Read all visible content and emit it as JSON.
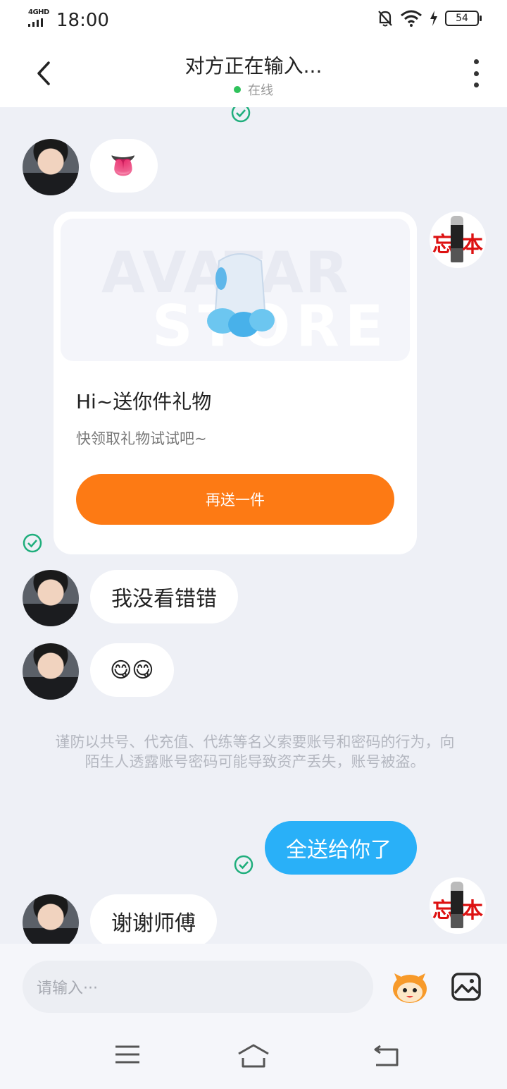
{
  "status_bar": {
    "network": "4GHD",
    "time": "18:00",
    "battery": "54"
  },
  "header": {
    "title": "对方正在输入...",
    "status": "在线"
  },
  "messages": {
    "m1_emoji": "👅",
    "gift": {
      "title": "Hi~送你件礼物",
      "subtitle": "快领取礼物试试吧~",
      "button": "再送一件",
      "watermark1": "AVATAR",
      "watermark2": "STORE"
    },
    "m2": "我没看错错",
    "m3_emoji": "😋😋",
    "warning": "谨防以共号、代充值、代练等名义索要账号和密码的行为，向陌生人透露账号密码可能导致资产丢失，账号被盗。",
    "m4": "全送给你了",
    "m5": "谢谢师傅"
  },
  "avatar_me": {
    "char1": "忘",
    "char2": "本"
  },
  "input": {
    "placeholder": "请输入···"
  },
  "colors": {
    "accent_blue": "#29b0f8",
    "gift_orange": "#fd7a14",
    "online_green": "#2fc25b",
    "check_green": "#1fae7c"
  },
  "icons": [
    "back-icon",
    "more-icon",
    "check-icon",
    "emoji-icon",
    "image-icon",
    "menu-icon",
    "home-icon",
    "return-icon"
  ]
}
